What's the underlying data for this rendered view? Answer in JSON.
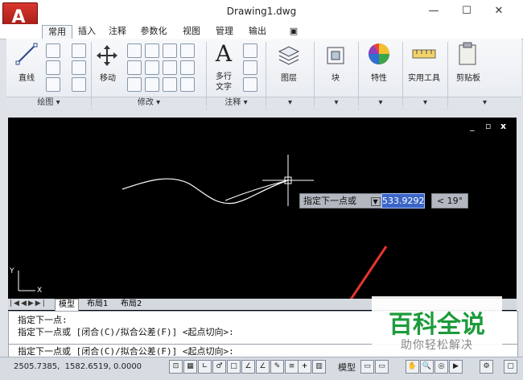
{
  "window": {
    "title": "Drawing1.dwg",
    "app_logo": "A",
    "controls": [
      "—",
      "☐",
      "✕"
    ]
  },
  "ribbon_tabs": [
    "常用",
    "插入",
    "注释",
    "参数化",
    "视图",
    "管理",
    "输出",
    "▣"
  ],
  "ribbon": {
    "big_buttons": {
      "line": "直线",
      "move": "移动",
      "mtext_1": "多行",
      "mtext_2": "文字",
      "layer": "图层",
      "block": "块",
      "properties": "特性",
      "utilities": "实用工具",
      "clipboard": "剪贴板"
    },
    "panels": {
      "draw": "绘图",
      "modify": "修改",
      "annotation": "注释"
    }
  },
  "viewport": {
    "controls": [
      "_",
      "▫",
      "x"
    ],
    "axis_y": "Y",
    "axis_x": "X"
  },
  "dynamic_input": {
    "prompt": "指定下一点或",
    "length": "533.9292",
    "angle": "< 19°"
  },
  "sheet_tabs": [
    "模型",
    "布局1",
    "布局2"
  ],
  "command_history": [
    "指定下一点:",
    "指定下一点或 [闭合(C)/拟合公差(F)] <起点切向>:"
  ],
  "command_line": "指定下一点或 [闭合(C)/拟合公差(F)] <起点切向>:",
  "status": {
    "coordinates": "2505.7385,  1582.6519, 0.0000",
    "model_label": "模型"
  },
  "watermark": {
    "line1": "百科全说",
    "line2": "助你轻松解决"
  },
  "colors": {
    "app_red": "#c0251c",
    "canvas": "#000000",
    "input_highlight": "#3b66c8",
    "annotation_arrow": "#e8342a",
    "watermark_green": "#1c9b3a"
  }
}
